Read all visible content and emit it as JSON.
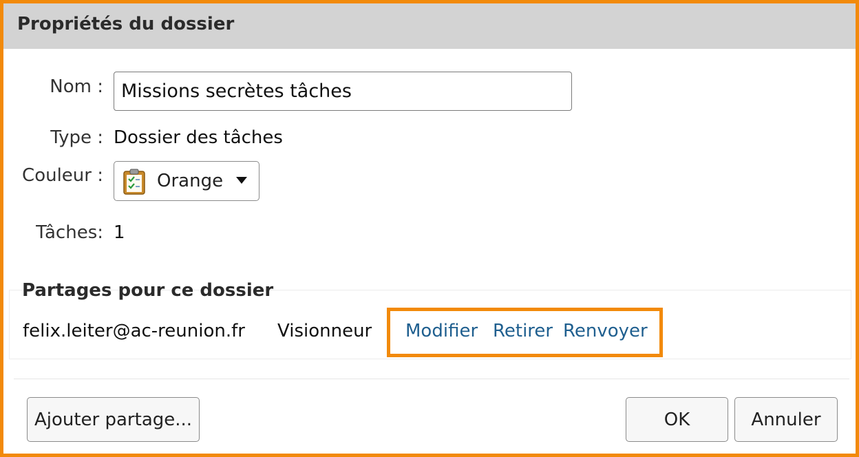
{
  "dialog": {
    "title": "Propriétés du dossier"
  },
  "form": {
    "name_label": "Nom :",
    "name_value": "Missions secrètes tâches",
    "type_label": "Type :",
    "type_value": "Dossier des tâches",
    "color_label": "Couleur :",
    "color_value": "Orange",
    "color_icon": "clipboard-task-icon",
    "tasks_label": "Tâches:",
    "tasks_value": "1"
  },
  "shares": {
    "title": "Partages pour ce dossier",
    "rows": [
      {
        "email": "felix.leiter@ac-reunion.fr",
        "role": "Visionneur",
        "actions": [
          "Modifier",
          "Retirer",
          "Renvoyer"
        ]
      }
    ]
  },
  "footer": {
    "add_share_label": "Ajouter partage...",
    "ok_label": "OK",
    "cancel_label": "Annuler"
  },
  "colors": {
    "highlight": "#f28a0a",
    "titlebar": "#d3d3d3",
    "link": "#1f5f8f"
  }
}
